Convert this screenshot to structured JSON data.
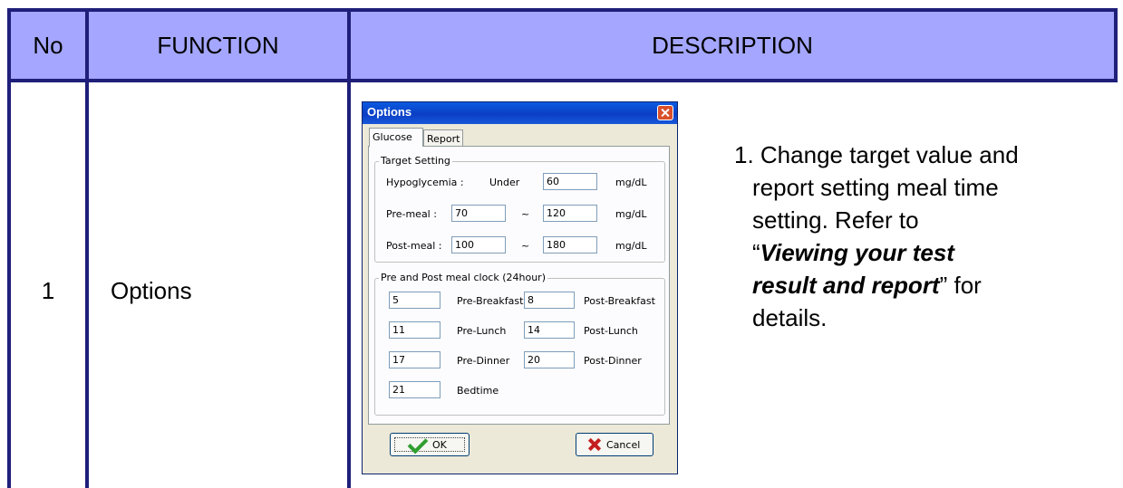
{
  "table": {
    "headers": [
      "No",
      "FUNCTION",
      "DESCRIPTION"
    ],
    "row": {
      "no": "1",
      "function": "Options"
    }
  },
  "dialog": {
    "title": "Options",
    "tabs": [
      "Glucose",
      "Report"
    ],
    "target_setting": {
      "label": "Target Setting",
      "hypo_label": "Hypoglycemia :",
      "under_label": "Under",
      "hypo_value": "60",
      "premeal_label": "Pre-meal :",
      "premeal_low": "70",
      "premeal_high": "120",
      "postmeal_label": "Post-meal :",
      "postmeal_low": "100",
      "postmeal_high": "180",
      "tilde": "~",
      "unit": "mg/dL"
    },
    "clock": {
      "label": "Pre and  Post meal clock (24hour)",
      "pre_breakfast": "5",
      "pre_breakfast_label": "Pre-Breakfast",
      "post_breakfast": "8",
      "post_breakfast_label": "Post-Breakfast",
      "pre_lunch": "11",
      "pre_lunch_label": "Pre-Lunch",
      "post_lunch": "14",
      "post_lunch_label": "Post-Lunch",
      "pre_dinner": "17",
      "pre_dinner_label": "Pre-Dinner",
      "post_dinner": "20",
      "post_dinner_label": "Post-Dinner",
      "bedtime": "21",
      "bedtime_label": "Bedtime"
    },
    "ok_label": "OK",
    "cancel_label": "Cancel"
  },
  "description": {
    "line1": "1. Change target value and",
    "line2": "report setting meal time",
    "line3": "setting. Refer to",
    "quote_open": "“",
    "emph1": "Viewing your test",
    "emph2": "result and report",
    "quote_close": "” for",
    "line6": "details."
  },
  "colors": {
    "header_bg": "#a4a6ff",
    "rule": "#1f1f7a"
  }
}
